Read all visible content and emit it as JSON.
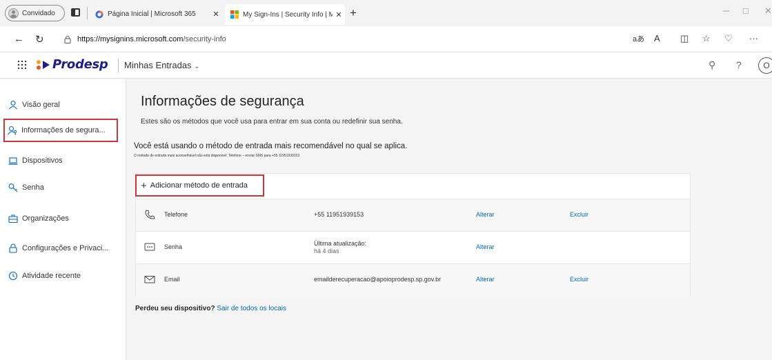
{
  "browser": {
    "guest_label": "Convidado",
    "tabs": [
      {
        "title": "Página Inicial | Microsoft 365",
        "close": "✕"
      },
      {
        "title": "My Sign-Ins | Security Info | Micro",
        "close": "✕"
      }
    ],
    "new_tab": "+",
    "url_host": "https://mysignins.microsoft.com",
    "url_path": "/security-info",
    "reader_icon": "aあ",
    "read_aloud_icon": "A"
  },
  "header": {
    "brand": "Prodesp",
    "app_name": "Minhas Entradas",
    "help": "?",
    "avatar_initial": "O",
    "brand_color": "#1f1f8a"
  },
  "sidebar": {
    "items": [
      {
        "label": "Visão geral"
      },
      {
        "label": "Informações de segura..."
      },
      {
        "label": "Dispositivos"
      },
      {
        "label": "Senha"
      },
      {
        "label": "Organizações"
      },
      {
        "label": "Configurações e Privaci..."
      },
      {
        "label": "Atividade recente"
      }
    ],
    "accent_color": "#0067b8",
    "highlight_color": "#d13438"
  },
  "main": {
    "title": "Informações de segurança",
    "subtitle": "Estes são os métodos que você usa para entrar em sua conta ou redefinir sua senha.",
    "recommend": "Você está usando o método de entrada mais recomendável no qual se aplica.",
    "note": "O método de entrada mais aconselhável não está disponível: Telefone – enviar SMS para +55 11951939153",
    "add_method": "Adicionar método de entrada",
    "methods": [
      {
        "name": "Telefone",
        "value": "+55 11951939153",
        "change": "Alterar",
        "delete": "Excluir"
      },
      {
        "name": "Senha",
        "value": "Última atualização:",
        "value_sub": "há 4 dias",
        "change": "Alterar"
      },
      {
        "name": "Email",
        "value": "emailderecuperacao@apoioprodesp.sp.gov.br",
        "change": "Alterar",
        "delete": "Excluir"
      }
    ],
    "lost_device": "Perdeu seu dispositivo?",
    "sign_out_all": "Sair de todos os locais"
  }
}
